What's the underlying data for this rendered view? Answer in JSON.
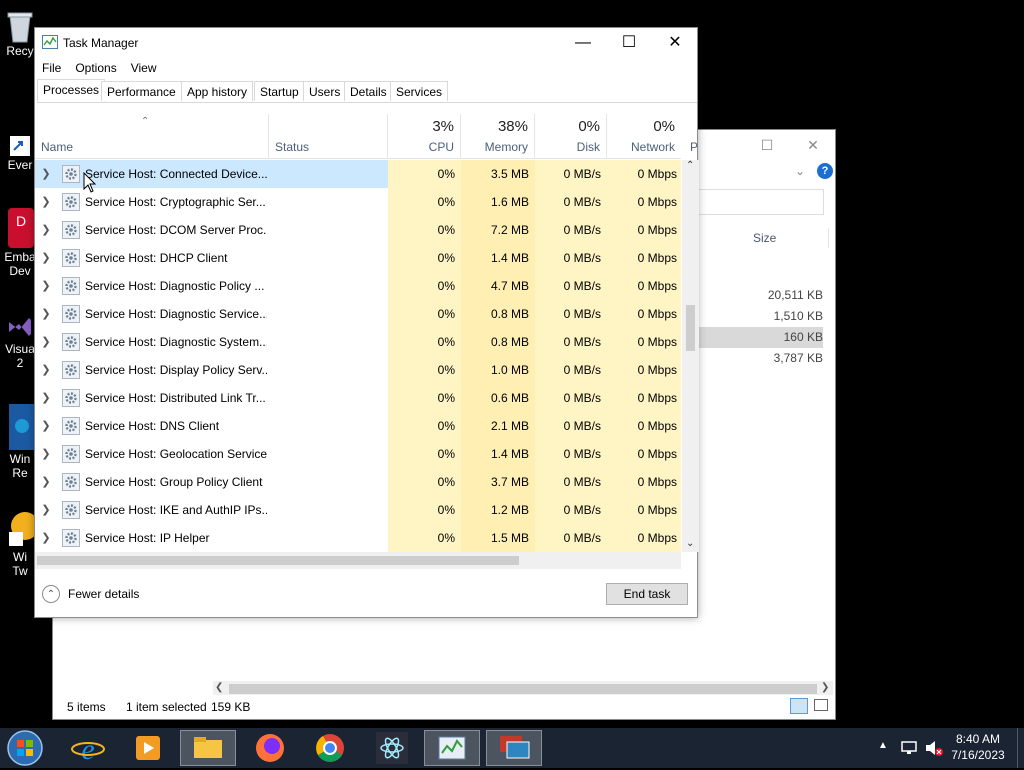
{
  "desktop": {
    "icons": [
      {
        "label": "Recy",
        "icon": "recycle-bin-icon"
      },
      {
        "label": "Ever",
        "icon": "shortcut-icon"
      },
      {
        "label": "Emba",
        "label2": "Dev",
        "icon": "embarcadero-icon"
      },
      {
        "label": "Visua",
        "label2": "2",
        "icon": "visual-studio-icon"
      },
      {
        "label": "Win",
        "label2": "Re",
        "icon": "app-icon"
      },
      {
        "label": "Wi",
        "label2": "Tw",
        "icon": "app-icon"
      }
    ]
  },
  "explorer": {
    "column_size": "Size",
    "sizes": [
      "20,511 KB",
      "1,510 KB",
      "160 KB",
      "3,787 KB"
    ],
    "selected_index": 2,
    "status": {
      "items": "5 items",
      "selected": "1 item selected",
      "size": "159 KB"
    }
  },
  "task_manager": {
    "title": "Task Manager",
    "menu": [
      "File",
      "Options",
      "View"
    ],
    "tabs": [
      "Processes",
      "Performance",
      "App history",
      "Startup",
      "Users",
      "Details",
      "Services"
    ],
    "active_tab": 0,
    "columns": {
      "name": "Name",
      "status": "Status",
      "cpu": {
        "pct": "3%",
        "label": "CPU"
      },
      "memory": {
        "pct": "38%",
        "label": "Memory"
      },
      "disk": {
        "pct": "0%",
        "label": "Disk"
      },
      "network": {
        "pct": "0%",
        "label": "Network"
      },
      "power": "P"
    },
    "rows": [
      {
        "name": "Service Host: Connected Device...",
        "cpu": "0%",
        "memory": "3.5 MB",
        "disk": "0 MB/s",
        "network": "0 Mbps"
      },
      {
        "name": "Service Host: Cryptographic Ser...",
        "cpu": "0%",
        "memory": "1.6 MB",
        "disk": "0 MB/s",
        "network": "0 Mbps"
      },
      {
        "name": "Service Host: DCOM Server Proc...",
        "cpu": "0%",
        "memory": "7.2 MB",
        "disk": "0 MB/s",
        "network": "0 Mbps"
      },
      {
        "name": "Service Host: DHCP Client",
        "cpu": "0%",
        "memory": "1.4 MB",
        "disk": "0 MB/s",
        "network": "0 Mbps"
      },
      {
        "name": "Service Host: Diagnostic Policy ...",
        "cpu": "0%",
        "memory": "4.7 MB",
        "disk": "0 MB/s",
        "network": "0 Mbps"
      },
      {
        "name": "Service Host: Diagnostic Service...",
        "cpu": "0%",
        "memory": "0.8 MB",
        "disk": "0 MB/s",
        "network": "0 Mbps"
      },
      {
        "name": "Service Host: Diagnostic System...",
        "cpu": "0%",
        "memory": "0.8 MB",
        "disk": "0 MB/s",
        "network": "0 Mbps"
      },
      {
        "name": "Service Host: Display Policy Serv...",
        "cpu": "0%",
        "memory": "1.0 MB",
        "disk": "0 MB/s",
        "network": "0 Mbps"
      },
      {
        "name": "Service Host: Distributed Link Tr...",
        "cpu": "0%",
        "memory": "0.6 MB",
        "disk": "0 MB/s",
        "network": "0 Mbps"
      },
      {
        "name": "Service Host: DNS Client",
        "cpu": "0%",
        "memory": "2.1 MB",
        "disk": "0 MB/s",
        "network": "0 Mbps"
      },
      {
        "name": "Service Host: Geolocation Service",
        "cpu": "0%",
        "memory": "1.4 MB",
        "disk": "0 MB/s",
        "network": "0 Mbps"
      },
      {
        "name": "Service Host: Group Policy Client",
        "cpu": "0%",
        "memory": "3.7 MB",
        "disk": "0 MB/s",
        "network": "0 Mbps"
      },
      {
        "name": "Service Host: IKE and AuthIP IPs...",
        "cpu": "0%",
        "memory": "1.2 MB",
        "disk": "0 MB/s",
        "network": "0 Mbps"
      },
      {
        "name": "Service Host: IP Helper",
        "cpu": "0%",
        "memory": "1.5 MB",
        "disk": "0 MB/s",
        "network": "0 Mbps"
      }
    ],
    "selected_row": 0,
    "fewer_details": "Fewer details",
    "end_task": "End task"
  },
  "taskbar": {
    "apps": [
      "internet-explorer-icon",
      "media-player-icon",
      "file-explorer-icon",
      "firefox-icon",
      "chrome-icon",
      "electron-icon",
      "task-manager-icon",
      "remote-desktop-icon"
    ],
    "time": "8:40 AM",
    "date": "7/16/2023"
  },
  "colors": {
    "accent": "#0078d7",
    "heat_light": "#fff4c4",
    "heat_mem": "#ffefb3",
    "selection": "#cce8ff",
    "taskbar": "#1a2433"
  }
}
